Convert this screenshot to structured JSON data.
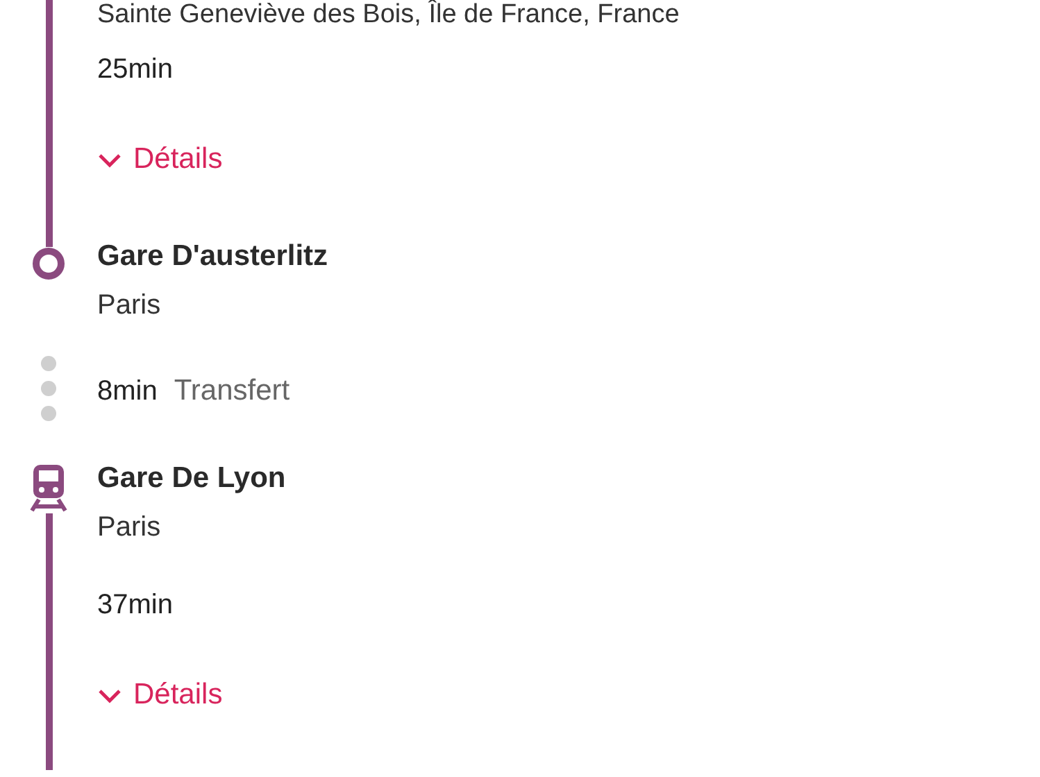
{
  "itinerary": [
    {
      "kind": "segment",
      "place": "Sainte Geneviève des Bois, Île de France, France",
      "duration": "25min",
      "details": "Détails"
    },
    {
      "kind": "stop",
      "name": "Gare D'austerlitz",
      "city": "Paris"
    },
    {
      "kind": "transfer",
      "duration": "8min",
      "label": "Transfert"
    },
    {
      "kind": "boarding",
      "name": "Gare De Lyon",
      "city": "Paris"
    },
    {
      "kind": "segment",
      "duration": "37min",
      "details": "Détails"
    }
  ]
}
